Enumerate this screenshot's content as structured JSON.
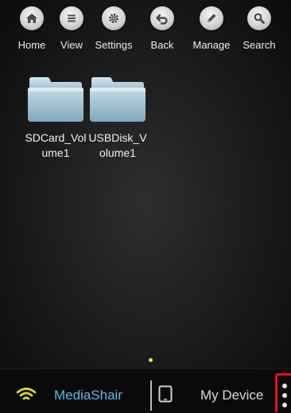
{
  "toolbar": {
    "items": [
      {
        "label": "Home",
        "icon": "home-icon"
      },
      {
        "label": "View",
        "icon": "list-icon"
      },
      {
        "label": "Settings",
        "icon": "gear-icon"
      },
      {
        "label": "Back",
        "icon": "back-arrow-icon"
      },
      {
        "label": "Manage",
        "icon": "pencil-icon"
      },
      {
        "label": "Search",
        "icon": "search-icon"
      }
    ]
  },
  "files": {
    "items": [
      {
        "name": "SDCard_Volume1",
        "icon": "folder-icon"
      },
      {
        "name": "USBDisk_Volume1",
        "icon": "folder-icon"
      }
    ]
  },
  "pager": {
    "current_page": 1,
    "accent": "#d9e84b"
  },
  "bottom_bar": {
    "mediashair_label": "MediaShair",
    "mediashair_color": "#5fb8e6",
    "mydevice_label": "My Device",
    "mydevice_color": "#d8d8d8",
    "wifi_color": "#e8e020",
    "menu_highlight_color": "#e3111b"
  }
}
